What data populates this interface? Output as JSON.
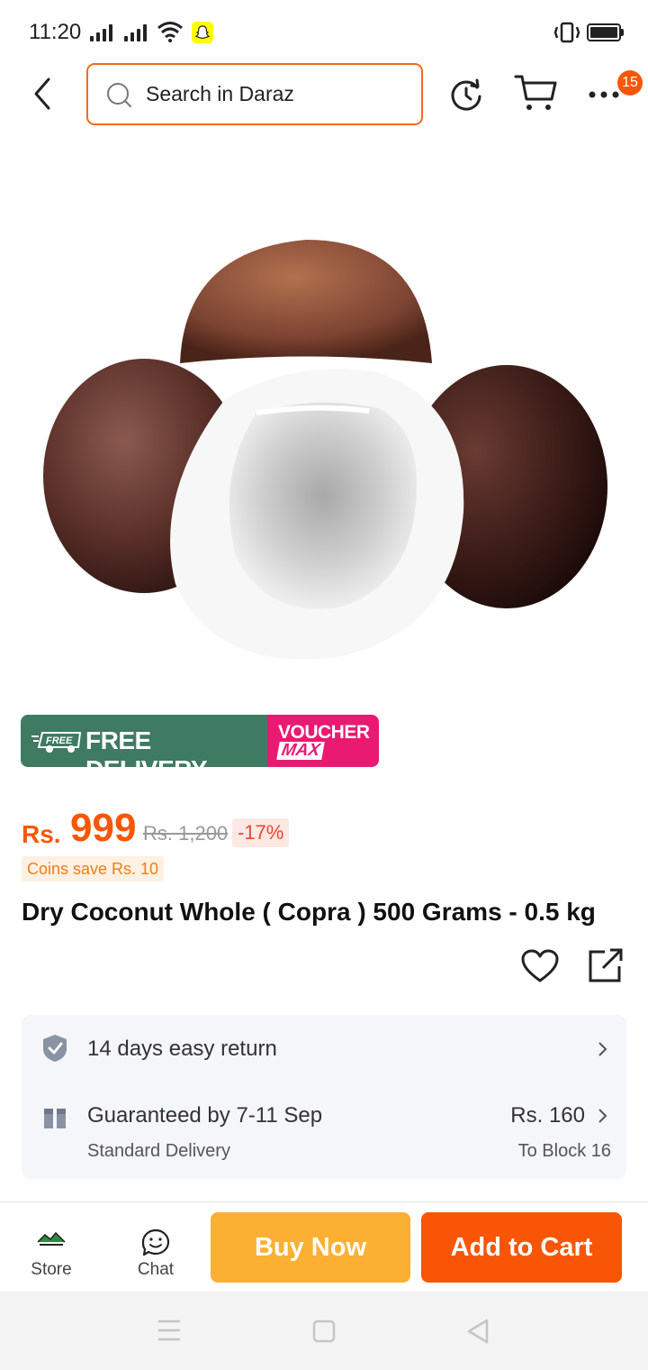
{
  "status_bar": {
    "time": "11:20"
  },
  "header": {
    "search_placeholder": "Search in Daraz",
    "more_badge": "15"
  },
  "promo": {
    "free_tag": "FREE",
    "free_delivery": "FREE DELIVERY",
    "voucher": "VOUCHER",
    "max": "MAX"
  },
  "product": {
    "currency": "Rs.",
    "price": "999",
    "original_price": "Rs. 1,200",
    "discount": "-17%",
    "coins_save": "Coins save Rs. 10",
    "title": "Dry Coconut Whole ( Copra ) 500 Grams - 0.5 kg"
  },
  "services": {
    "return_policy": "14 days easy return",
    "delivery_guarantee": "Guaranteed by 7-11 Sep",
    "delivery_type": "Standard Delivery",
    "delivery_fee": "Rs. 160",
    "delivery_location": "To Block 16"
  },
  "actions": {
    "store_label": "Store",
    "chat_label": "Chat",
    "buy_now": "Buy Now",
    "add_to_cart": "Add to Cart"
  },
  "colors": {
    "brand_orange": "#f85606",
    "buy_now_yellow": "#fbb034",
    "free_delivery_green": "#3f7a62",
    "voucher_pink": "#ea1a73"
  }
}
